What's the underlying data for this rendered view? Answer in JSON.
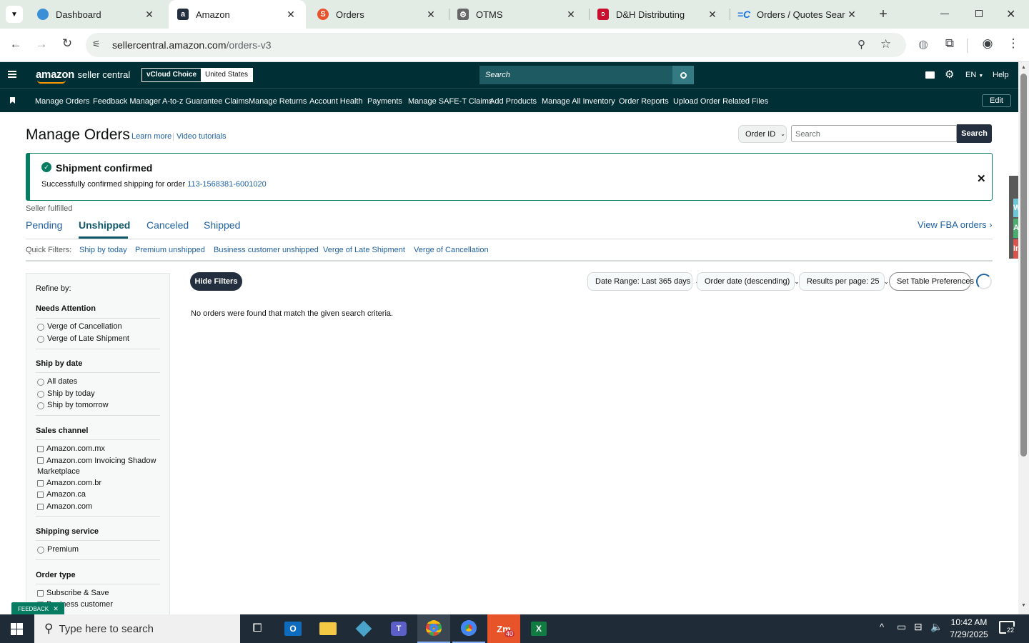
{
  "browser": {
    "tabs": [
      {
        "title": "Dashboard",
        "icon": "dashboard-favicon",
        "color": "#3b8fd6"
      },
      {
        "title": "Amazon",
        "icon": "amazon-favicon",
        "color": "#232f3e"
      },
      {
        "title": "Orders",
        "icon": "orders-favicon",
        "color": "#e8532d"
      },
      {
        "title": "OTMS",
        "icon": "otms-favicon",
        "color": "#444444"
      },
      {
        "title": "D&H Distributing",
        "icon": "dh-favicon",
        "color": "#c8102e"
      },
      {
        "title": "Orders / Quotes Search",
        "icon": "orders-quotes-favicon",
        "color": "#1a73e8"
      }
    ],
    "new_tab": "+",
    "url_host": "sellercentral.amazon.com",
    "url_path": "/orders-v3"
  },
  "header": {
    "logo_main": "amazon",
    "logo_sub": "seller central",
    "store_name": "vCloud Choice",
    "store_region": "United States",
    "search_placeholder": "Search",
    "language": "EN",
    "help": "Help"
  },
  "nav": {
    "items": [
      "Manage Orders",
      "Feedback Manager",
      "A-to-z Guarantee Claims",
      "Manage Returns",
      "Account Health",
      "Payments",
      "Manage SAFE-T Claims",
      "Add Products",
      "Manage All Inventory",
      "Order Reports",
      "Upload Order Related Files"
    ],
    "edit": "Edit"
  },
  "page": {
    "title": "Manage Orders",
    "learn_more": "Learn more",
    "video_tutorials": "Video tutorials",
    "search_type": "Order ID",
    "search_placeholder": "Search",
    "search_button": "Search"
  },
  "alert": {
    "title": "Shipment confirmed",
    "message": "Successfully confirmed shipping for order",
    "order_id": "113-1568381-6001020",
    "color": "#067d62"
  },
  "tabs": {
    "label": "Seller fulfilled",
    "items": [
      "Pending",
      "Unshipped",
      "Canceled",
      "Shipped"
    ],
    "active": "Unshipped",
    "fba": "View FBA orders"
  },
  "quick_filters": {
    "label": "Quick Filters:",
    "items": [
      "Ship by today",
      "Premium unshipped",
      "Business customer unshipped",
      "Verge of Late Shipment",
      "Verge of Cancellation"
    ]
  },
  "sidebar": {
    "refine": "Refine by:",
    "needs_attention": {
      "title": "Needs Attention",
      "items": [
        "Verge of Cancellation",
        "Verge of Late Shipment"
      ]
    },
    "ship_by": {
      "title": "Ship by date",
      "items": [
        "All dates",
        "Ship by today",
        "Ship by tomorrow"
      ]
    },
    "sales_channel": {
      "title": "Sales channel",
      "items": [
        "Amazon.com.mx",
        "Amazon.com Invoicing Shadow Marketplace",
        "Amazon.com.br",
        "Amazon.ca",
        "Amazon.com"
      ]
    },
    "shipping_service": {
      "title": "Shipping service",
      "items": [
        "Premium"
      ]
    },
    "order_type": {
      "title": "Order type",
      "items": [
        "Subscribe & Save",
        "Business customer"
      ]
    }
  },
  "toolbar": {
    "hide_filters": "Hide Filters",
    "date_range": "Date Range: Last 365 days",
    "sort": "Order date (descending)",
    "per_page": "Results per page: 25",
    "table_prefs": "Set Table Preferences"
  },
  "results": {
    "empty": "No orders were found that match the given search criteria."
  },
  "feedback": "FEEDBACK",
  "side_tabs": [
    "W",
    "Ad",
    "In"
  ],
  "taskbar": {
    "search_placeholder": "Type here to search",
    "time": "10:42 AM",
    "date": "7/29/2025",
    "zoom_badge": "40",
    "notifications": "22"
  }
}
